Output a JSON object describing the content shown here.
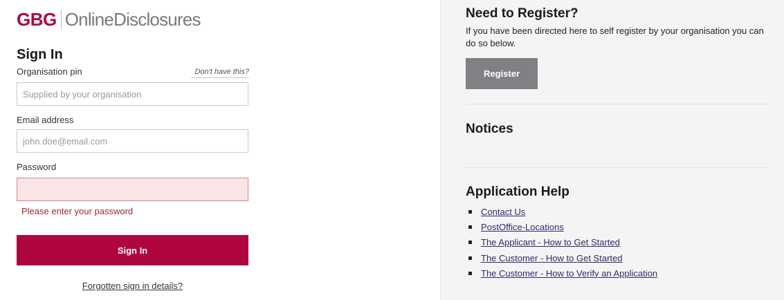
{
  "brand": {
    "logo_mark": "GBG",
    "product_name": "OnlineDisclosures"
  },
  "signin": {
    "title": "Sign In",
    "org_pin_label": "Organisation pin",
    "dont_have_link": "Don't have this?",
    "org_pin_placeholder": "Supplied by your organisation",
    "org_pin_value": "",
    "email_label": "Email address",
    "email_placeholder": "john.doe@email.com",
    "email_value": "",
    "password_label": "Password",
    "password_value": "",
    "password_error": "Please enter your password",
    "submit_label": "Sign In",
    "forgot_link": "Forgotten sign in details?"
  },
  "register": {
    "title": "Need to Register?",
    "description": "If you have been directed here to self register by your organisation you can do so below.",
    "button_label": "Register"
  },
  "notices": {
    "title": "Notices"
  },
  "help": {
    "title": "Application Help",
    "links": [
      "Contact Us",
      "PostOffice-Locations",
      "The Applicant - How to Get Started",
      "The Customer - How to Get Started",
      "The Customer - How to Verify an Application"
    ]
  },
  "colors": {
    "brand_accent": "#b0063f",
    "register_button": "#7f8184",
    "error_text": "#a5262e",
    "error_field_bg": "#f9e4e6",
    "right_panel_bg": "#f4f4f4"
  }
}
